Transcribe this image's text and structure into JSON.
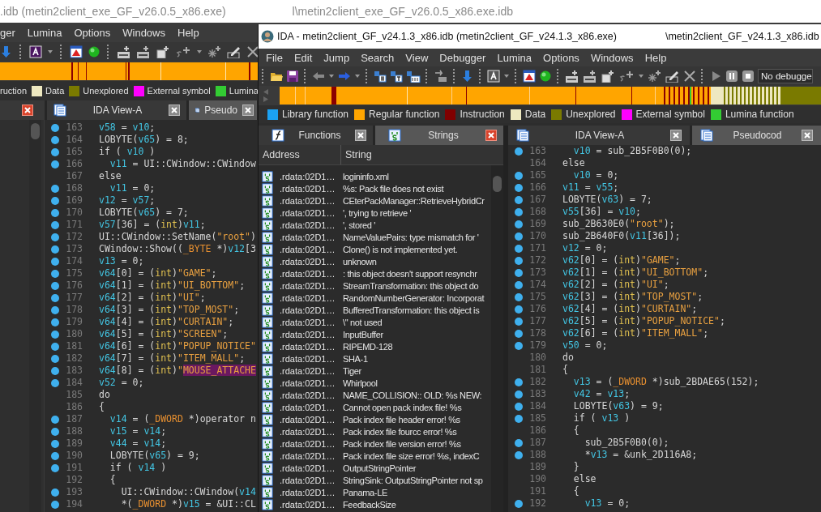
{
  "back_window": {
    "title": ".idb (metin2client_exe_GF_v26.0.5_x86.exe)",
    "title_path": "l\\metin2client_exe_GF_v26.0.5_x86.exe.idb",
    "menu": [
      "ger",
      "Lumina",
      "Options",
      "Windows",
      "Help"
    ],
    "legend": [
      {
        "label": "ruction"
      },
      {
        "label": "Data",
        "color": "#eee8c0"
      },
      {
        "label": "Unexplored",
        "color": "#7a7a00"
      },
      {
        "label": "External symbol",
        "color": "#ff00ff"
      },
      {
        "label": "Lumina",
        "color": "#33cc33"
      }
    ],
    "tabs": [
      {
        "selected": false,
        "active": true
      },
      {
        "label": "IDA View-A",
        "selected": false,
        "active": false
      },
      {
        "label": "Pseudo",
        "selected": true,
        "active": false
      }
    ],
    "code_lines": [
      {
        "no": "163",
        "dot": true,
        "kind": "top",
        "tokens": [
          {
            "kind": "var",
            "text": "v58"
          },
          {
            "kind": "plain",
            "text": " = "
          },
          {
            "kind": "var",
            "text": "v10"
          },
          {
            "kind": "plain",
            "text": ";"
          }
        ]
      },
      {
        "no": "164",
        "dot": true,
        "kind": "top",
        "tokens": [
          {
            "kind": "plain",
            "text": "LOBYTE("
          },
          {
            "kind": "var",
            "text": "v65"
          },
          {
            "kind": "plain",
            "text": ") = 8;"
          }
        ]
      },
      {
        "no": "165",
        "dot": true,
        "kind": "top",
        "tokens": [
          {
            "kind": "plain",
            "text": "if ( "
          },
          {
            "kind": "var",
            "text": "v10"
          },
          {
            "kind": "plain",
            "text": " )"
          }
        ]
      },
      {
        "no": "166",
        "dot": true,
        "kind": "inner",
        "tokens": [
          {
            "kind": "var",
            "text": "v11"
          },
          {
            "kind": "plain",
            "text": " = UI::CWindow::CWindow"
          }
        ]
      },
      {
        "no": "167",
        "dot": false,
        "kind": "top",
        "tokens": [
          {
            "kind": "plain",
            "text": "else"
          }
        ]
      },
      {
        "no": "168",
        "dot": true,
        "kind": "inner",
        "tokens": [
          {
            "kind": "var",
            "text": "v11"
          },
          {
            "kind": "plain",
            "text": " = 0;"
          }
        ]
      },
      {
        "no": "169",
        "dot": true,
        "kind": "top",
        "tokens": [
          {
            "kind": "var",
            "text": "v12"
          },
          {
            "kind": "plain",
            "text": " = "
          },
          {
            "kind": "var",
            "text": "v57"
          },
          {
            "kind": "plain",
            "text": ";"
          }
        ]
      },
      {
        "no": "170",
        "dot": true,
        "kind": "top",
        "tokens": [
          {
            "kind": "plain",
            "text": "LOBYTE("
          },
          {
            "kind": "var",
            "text": "v65"
          },
          {
            "kind": "plain",
            "text": ") = 7;"
          }
        ]
      },
      {
        "no": "171",
        "dot": true,
        "kind": "top",
        "tokens": [
          {
            "kind": "var",
            "text": "v57"
          },
          {
            "kind": "plain",
            "text": "[36] = ("
          },
          {
            "kind": "type",
            "text": "int"
          },
          {
            "kind": "plain",
            "text": ")"
          },
          {
            "kind": "var",
            "text": "v11"
          },
          {
            "kind": "plain",
            "text": ";"
          }
        ]
      },
      {
        "no": "172",
        "dot": true,
        "kind": "top",
        "tokens": [
          {
            "kind": "plain",
            "text": "UI::CWindow::SetName("
          },
          {
            "kind": "str",
            "text": "\"root\""
          },
          {
            "kind": "plain",
            "text": ")"
          }
        ]
      },
      {
        "no": "173",
        "dot": true,
        "kind": "top",
        "tokens": [
          {
            "kind": "plain",
            "text": "CWindow::Show(("
          },
          {
            "kind": "ptr",
            "text": "_BYTE"
          },
          {
            "kind": "plain",
            "text": " *)"
          },
          {
            "kind": "var",
            "text": "v12"
          },
          {
            "kind": "plain",
            "text": "[3"
          }
        ]
      },
      {
        "no": "174",
        "dot": true,
        "kind": "top",
        "tokens": [
          {
            "kind": "var",
            "text": "v13"
          },
          {
            "kind": "plain",
            "text": " = 0;"
          }
        ]
      },
      {
        "no": "175",
        "dot": true,
        "kind": "top",
        "tokens": [
          {
            "kind": "var",
            "text": "v64"
          },
          {
            "kind": "plain",
            "text": "[0] = ("
          },
          {
            "kind": "type",
            "text": "int"
          },
          {
            "kind": "plain",
            "text": ")"
          },
          {
            "kind": "str",
            "text": "\"GAME\""
          },
          {
            "kind": "plain",
            "text": ";"
          }
        ]
      },
      {
        "no": "176",
        "dot": true,
        "kind": "top",
        "tokens": [
          {
            "kind": "var",
            "text": "v64"
          },
          {
            "kind": "plain",
            "text": "[1] = ("
          },
          {
            "kind": "type",
            "text": "int"
          },
          {
            "kind": "plain",
            "text": ")"
          },
          {
            "kind": "str",
            "text": "\"UI_BOTTOM\""
          },
          {
            "kind": "plain",
            "text": ";"
          }
        ]
      },
      {
        "no": "177",
        "dot": true,
        "kind": "top",
        "tokens": [
          {
            "kind": "var",
            "text": "v64"
          },
          {
            "kind": "plain",
            "text": "[2] = ("
          },
          {
            "kind": "type",
            "text": "int"
          },
          {
            "kind": "plain",
            "text": ")"
          },
          {
            "kind": "str",
            "text": "\"UI\""
          },
          {
            "kind": "plain",
            "text": ";"
          }
        ]
      },
      {
        "no": "178",
        "dot": true,
        "kind": "top",
        "tokens": [
          {
            "kind": "var",
            "text": "v64"
          },
          {
            "kind": "plain",
            "text": "[3] = ("
          },
          {
            "kind": "type",
            "text": "int"
          },
          {
            "kind": "plain",
            "text": ")"
          },
          {
            "kind": "str",
            "text": "\"TOP_MOST\""
          },
          {
            "kind": "plain",
            "text": ";"
          }
        ]
      },
      {
        "no": "179",
        "dot": true,
        "kind": "top",
        "tokens": [
          {
            "kind": "var",
            "text": "v64"
          },
          {
            "kind": "plain",
            "text": "[4] = ("
          },
          {
            "kind": "type",
            "text": "int"
          },
          {
            "kind": "plain",
            "text": ")"
          },
          {
            "kind": "str",
            "text": "\"CURTAIN\""
          },
          {
            "kind": "plain",
            "text": ";"
          }
        ]
      },
      {
        "no": "180",
        "dot": true,
        "kind": "top",
        "tokens": [
          {
            "kind": "var",
            "text": "v64"
          },
          {
            "kind": "plain",
            "text": "[5] = ("
          },
          {
            "kind": "type",
            "text": "int"
          },
          {
            "kind": "plain",
            "text": ")"
          },
          {
            "kind": "str",
            "text": "\"SCREEN\""
          },
          {
            "kind": "plain",
            "text": ";"
          }
        ]
      },
      {
        "no": "181",
        "dot": true,
        "kind": "top",
        "tokens": [
          {
            "kind": "var",
            "text": "v64"
          },
          {
            "kind": "plain",
            "text": "[6] = ("
          },
          {
            "kind": "type",
            "text": "int"
          },
          {
            "kind": "plain",
            "text": ")"
          },
          {
            "kind": "str",
            "text": "\"POPUP_NOTICE\""
          }
        ]
      },
      {
        "no": "182",
        "dot": true,
        "kind": "top",
        "tokens": [
          {
            "kind": "var",
            "text": "v64"
          },
          {
            "kind": "plain",
            "text": "[7] = ("
          },
          {
            "kind": "type",
            "text": "int"
          },
          {
            "kind": "plain",
            "text": ")"
          },
          {
            "kind": "str",
            "text": "\"ITEM_MALL\""
          },
          {
            "kind": "plain",
            "text": ";"
          }
        ]
      },
      {
        "no": "183",
        "dot": true,
        "kind": "top",
        "tokens": [
          {
            "kind": "var",
            "text": "v64"
          },
          {
            "kind": "plain",
            "text": "[8] = ("
          },
          {
            "kind": "type",
            "text": "int"
          },
          {
            "kind": "plain",
            "text": ")"
          },
          {
            "kind": "str",
            "text": "\""
          },
          {
            "kind": "match",
            "text": "MOUSE_ATTACHE"
          }
        ]
      },
      {
        "no": "184",
        "dot": true,
        "kind": "top",
        "tokens": [
          {
            "kind": "var",
            "text": "v52"
          },
          {
            "kind": "plain",
            "text": " = 0;"
          }
        ]
      },
      {
        "no": "185",
        "dot": false,
        "kind": "top",
        "tokens": [
          {
            "kind": "plain",
            "text": "do"
          }
        ]
      },
      {
        "no": "186",
        "dot": false,
        "kind": "top",
        "tokens": [
          {
            "kind": "plain",
            "text": "{"
          }
        ]
      },
      {
        "no": "187",
        "dot": true,
        "kind": "inner",
        "tokens": [
          {
            "kind": "var",
            "text": "v14"
          },
          {
            "kind": "plain",
            "text": " = ("
          },
          {
            "kind": "ptr",
            "text": "_DWORD"
          },
          {
            "kind": "plain",
            "text": " *)operator n"
          }
        ]
      },
      {
        "no": "188",
        "dot": true,
        "kind": "inner",
        "tokens": [
          {
            "kind": "var",
            "text": "v15"
          },
          {
            "kind": "plain",
            "text": " = "
          },
          {
            "kind": "var",
            "text": "v14"
          },
          {
            "kind": "plain",
            "text": ";"
          }
        ]
      },
      {
        "no": "189",
        "dot": true,
        "kind": "inner",
        "tokens": [
          {
            "kind": "var",
            "text": "v44"
          },
          {
            "kind": "plain",
            "text": " = "
          },
          {
            "kind": "var",
            "text": "v14"
          },
          {
            "kind": "plain",
            "text": ";"
          }
        ]
      },
      {
        "no": "190",
        "dot": true,
        "kind": "inner",
        "tokens": [
          {
            "kind": "plain",
            "text": "LOBYTE("
          },
          {
            "kind": "var",
            "text": "v65"
          },
          {
            "kind": "plain",
            "text": ") = 9;"
          }
        ]
      },
      {
        "no": "191",
        "dot": true,
        "kind": "inner",
        "tokens": [
          {
            "kind": "plain",
            "text": "if ( "
          },
          {
            "kind": "var",
            "text": "v14"
          },
          {
            "kind": "plain",
            "text": " )"
          }
        ]
      },
      {
        "no": "192",
        "dot": false,
        "kind": "inner",
        "tokens": [
          {
            "kind": "plain",
            "text": "{"
          }
        ]
      },
      {
        "no": "193",
        "dot": true,
        "kind": "deep",
        "tokens": [
          {
            "kind": "plain",
            "text": "UI::CWindow::CWindow("
          },
          {
            "kind": "var",
            "text": "v14"
          }
        ]
      },
      {
        "no": "194",
        "dot": true,
        "kind": "deep",
        "tokens": [
          {
            "kind": "plain",
            "text": "*("
          },
          {
            "kind": "ptr",
            "text": "_DWORD"
          },
          {
            "kind": "plain",
            "text": " *)"
          },
          {
            "kind": "var",
            "text": "v15"
          },
          {
            "kind": "plain",
            "text": " = &UI::CL"
          }
        ]
      }
    ]
  },
  "front_window": {
    "title": "IDA - metin2client_GF_v24.1.3_x86.idb (metin2client_GF_v24.1.3_x86.exe)",
    "title_path": "\\metin2client_GF_v24.1.3_x86.idb",
    "menu": [
      "File",
      "Edit",
      "Jump",
      "Search",
      "View",
      "Debugger",
      "Lumina",
      "Options",
      "Windows",
      "Help"
    ],
    "debugger_select": {
      "value": "No debugge"
    },
    "legend": [
      {
        "label": "Library function",
        "color": "#1ba1f2"
      },
      {
        "label": "Regular function",
        "color": "#ffa500"
      },
      {
        "label": "Instruction",
        "color": "#800000"
      },
      {
        "label": "Data",
        "color": "#eee8c0"
      },
      {
        "label": "Unexplored",
        "color": "#7a7a00"
      },
      {
        "label": "External symbol",
        "color": "#ff00ff"
      },
      {
        "label": "Lumina function",
        "color": "#33cc33"
      }
    ],
    "left_tabs": [
      {
        "kind": "functions",
        "label": "Functions",
        "selected": false,
        "active": false
      },
      {
        "kind": "strings",
        "label": "Strings",
        "selected": true,
        "active": true
      }
    ],
    "strings_table": {
      "columns": [
        "Address",
        "String"
      ],
      "rows": [
        {
          "address": ".rdata:02D1…",
          "string": "logininfo.xml"
        },
        {
          "address": ".rdata:02D1…",
          "string": "%s: Pack file does not exist"
        },
        {
          "address": ".rdata:02D1…",
          "string": "CEterPackManager::RetrieveHybridCr"
        },
        {
          "address": ".rdata:02D1…",
          "string": "', trying to retrieve '"
        },
        {
          "address": ".rdata:02D1…",
          "string": "', stored '"
        },
        {
          "address": ".rdata:02D1…",
          "string": "NameValuePairs: type mismatch for '"
        },
        {
          "address": ".rdata:02D1…",
          "string": "Clone() is not implemented yet."
        },
        {
          "address": ".rdata:02D1…",
          "string": "unknown"
        },
        {
          "address": ".rdata:02D1…",
          "string": ": this object doesn't support resynchr"
        },
        {
          "address": ".rdata:02D1…",
          "string": "StreamTransformation: this object do"
        },
        {
          "address": ".rdata:02D1…",
          "string": "RandomNumberGenerator: Incorporat"
        },
        {
          "address": ".rdata:02D1…",
          "string": "BufferedTransformation: this object is"
        },
        {
          "address": ".rdata:02D1…",
          "string": "\\\" not used"
        },
        {
          "address": ".rdata:02D1…",
          "string": "InputBuffer"
        },
        {
          "address": ".rdata:02D1…",
          "string": "RIPEMD-128"
        },
        {
          "address": ".rdata:02D1…",
          "string": "SHA-1"
        },
        {
          "address": ".rdata:02D1…",
          "string": "Tiger"
        },
        {
          "address": ".rdata:02D1…",
          "string": "Whirlpool"
        },
        {
          "address": ".rdata:02D1…",
          "string": "NAME_COLLISION:: OLD: %s NEW:"
        },
        {
          "address": ".rdata:02D1…",
          "string": "Cannot open pack index file! %s"
        },
        {
          "address": ".rdata:02D1…",
          "string": "Pack index file header error! %s"
        },
        {
          "address": ".rdata:02D1…",
          "string": "Pack index file fourcc error! %s"
        },
        {
          "address": ".rdata:02D1…",
          "string": "Pack index file version error! %s"
        },
        {
          "address": ".rdata:02D1…",
          "string": "Pack index file size error! %s, indexC"
        },
        {
          "address": ".rdata:02D1…",
          "string": "OutputStringPointer"
        },
        {
          "address": ".rdata:02D1…",
          "string": "StringSink: OutputStringPointer not sp"
        },
        {
          "address": ".rdata:02D1…",
          "string": "Panama-LE"
        },
        {
          "address": ".rdata:02D1…",
          "string": "FeedbackSize"
        }
      ]
    },
    "right_tabs": [
      {
        "label": "IDA View-A",
        "selected": false,
        "active": false
      },
      {
        "label": "Pseudocod",
        "selected": true,
        "active": false
      }
    ],
    "code_lines": [
      {
        "no": "163",
        "dot": true,
        "kind": "inner",
        "tokens": [
          {
            "kind": "var",
            "text": "v10"
          },
          {
            "kind": "plain",
            "text": " = sub_2B5F0B0(0);"
          }
        ]
      },
      {
        "no": "164",
        "dot": false,
        "kind": "top",
        "tokens": [
          {
            "kind": "plain",
            "text": "else"
          }
        ]
      },
      {
        "no": "165",
        "dot": true,
        "kind": "inner",
        "tokens": [
          {
            "kind": "var",
            "text": "v10"
          },
          {
            "kind": "plain",
            "text": " = 0;"
          }
        ]
      },
      {
        "no": "166",
        "dot": true,
        "kind": "top",
        "tokens": [
          {
            "kind": "var",
            "text": "v11"
          },
          {
            "kind": "plain",
            "text": " = "
          },
          {
            "kind": "var",
            "text": "v55"
          },
          {
            "kind": "plain",
            "text": ";"
          }
        ]
      },
      {
        "no": "167",
        "dot": true,
        "kind": "top",
        "tokens": [
          {
            "kind": "plain",
            "text": "LOBYTE("
          },
          {
            "kind": "var",
            "text": "v63"
          },
          {
            "kind": "plain",
            "text": ") = 7;"
          }
        ]
      },
      {
        "no": "168",
        "dot": true,
        "kind": "top",
        "tokens": [
          {
            "kind": "var",
            "text": "v55"
          },
          {
            "kind": "plain",
            "text": "[36] = "
          },
          {
            "kind": "var",
            "text": "v10"
          },
          {
            "kind": "plain",
            "text": ";"
          }
        ]
      },
      {
        "no": "169",
        "dot": true,
        "kind": "top",
        "tokens": [
          {
            "kind": "plain",
            "text": "sub_2B630E0("
          },
          {
            "kind": "str",
            "text": "\"root\""
          },
          {
            "kind": "plain",
            "text": ");"
          }
        ]
      },
      {
        "no": "170",
        "dot": true,
        "kind": "top",
        "tokens": [
          {
            "kind": "plain",
            "text": "sub_2B640F0("
          },
          {
            "kind": "var",
            "text": "v11"
          },
          {
            "kind": "plain",
            "text": "[36]);"
          }
        ]
      },
      {
        "no": "171",
        "dot": true,
        "kind": "top",
        "tokens": [
          {
            "kind": "var",
            "text": "v12"
          },
          {
            "kind": "plain",
            "text": " = 0;"
          }
        ]
      },
      {
        "no": "172",
        "dot": true,
        "kind": "top",
        "tokens": [
          {
            "kind": "var",
            "text": "v62"
          },
          {
            "kind": "plain",
            "text": "[0] = ("
          },
          {
            "kind": "type",
            "text": "int"
          },
          {
            "kind": "plain",
            "text": ")"
          },
          {
            "kind": "str",
            "text": "\"GAME\""
          },
          {
            "kind": "plain",
            "text": ";"
          }
        ]
      },
      {
        "no": "173",
        "dot": true,
        "kind": "top",
        "tokens": [
          {
            "kind": "var",
            "text": "v62"
          },
          {
            "kind": "plain",
            "text": "[1] = ("
          },
          {
            "kind": "type",
            "text": "int"
          },
          {
            "kind": "plain",
            "text": ")"
          },
          {
            "kind": "str",
            "text": "\"UI_BOTTOM\""
          },
          {
            "kind": "plain",
            "text": ";"
          }
        ]
      },
      {
        "no": "174",
        "dot": true,
        "kind": "top",
        "tokens": [
          {
            "kind": "var",
            "text": "v62"
          },
          {
            "kind": "plain",
            "text": "[2] = ("
          },
          {
            "kind": "type",
            "text": "int"
          },
          {
            "kind": "plain",
            "text": ")"
          },
          {
            "kind": "str",
            "text": "\"UI\""
          },
          {
            "kind": "plain",
            "text": ";"
          }
        ]
      },
      {
        "no": "175",
        "dot": true,
        "kind": "top",
        "tokens": [
          {
            "kind": "var",
            "text": "v62"
          },
          {
            "kind": "plain",
            "text": "[3] = ("
          },
          {
            "kind": "type",
            "text": "int"
          },
          {
            "kind": "plain",
            "text": ")"
          },
          {
            "kind": "str",
            "text": "\"TOP_MOST\""
          },
          {
            "kind": "plain",
            "text": ";"
          }
        ]
      },
      {
        "no": "176",
        "dot": true,
        "kind": "top",
        "tokens": [
          {
            "kind": "var",
            "text": "v62"
          },
          {
            "kind": "plain",
            "text": "[4] = ("
          },
          {
            "kind": "type",
            "text": "int"
          },
          {
            "kind": "plain",
            "text": ")"
          },
          {
            "kind": "str",
            "text": "\"CURTAIN\""
          },
          {
            "kind": "plain",
            "text": ";"
          }
        ]
      },
      {
        "no": "177",
        "dot": true,
        "kind": "top",
        "tokens": [
          {
            "kind": "var",
            "text": "v62"
          },
          {
            "kind": "plain",
            "text": "[5] = ("
          },
          {
            "kind": "type",
            "text": "int"
          },
          {
            "kind": "plain",
            "text": ")"
          },
          {
            "kind": "str",
            "text": "\"POPUP_NOTICE\""
          },
          {
            "kind": "plain",
            "text": ";"
          }
        ]
      },
      {
        "no": "178",
        "dot": true,
        "kind": "top",
        "tokens": [
          {
            "kind": "var",
            "text": "v62"
          },
          {
            "kind": "plain",
            "text": "[6] = ("
          },
          {
            "kind": "type",
            "text": "int"
          },
          {
            "kind": "plain",
            "text": ")"
          },
          {
            "kind": "str",
            "text": "\"ITEM_MALL\""
          },
          {
            "kind": "plain",
            "text": ";"
          }
        ]
      },
      {
        "no": "179",
        "dot": true,
        "kind": "top",
        "tokens": [
          {
            "kind": "var",
            "text": "v50"
          },
          {
            "kind": "plain",
            "text": " = 0;"
          }
        ]
      },
      {
        "no": "180",
        "dot": false,
        "kind": "top",
        "tokens": [
          {
            "kind": "plain",
            "text": "do"
          }
        ]
      },
      {
        "no": "181",
        "dot": false,
        "kind": "top",
        "tokens": [
          {
            "kind": "plain",
            "text": "{"
          }
        ]
      },
      {
        "no": "182",
        "dot": true,
        "kind": "inner",
        "tokens": [
          {
            "kind": "var",
            "text": "v13"
          },
          {
            "kind": "plain",
            "text": " = ("
          },
          {
            "kind": "ptr",
            "text": "_DWORD"
          },
          {
            "kind": "plain",
            "text": " *)sub_2BDAE65(152);"
          }
        ]
      },
      {
        "no": "183",
        "dot": true,
        "kind": "inner",
        "tokens": [
          {
            "kind": "var",
            "text": "v42"
          },
          {
            "kind": "plain",
            "text": " = "
          },
          {
            "kind": "var",
            "text": "v13"
          },
          {
            "kind": "plain",
            "text": ";"
          }
        ]
      },
      {
        "no": "184",
        "dot": true,
        "kind": "inner",
        "tokens": [
          {
            "kind": "plain",
            "text": "LOBYTE("
          },
          {
            "kind": "var",
            "text": "v63"
          },
          {
            "kind": "plain",
            "text": ") = 9;"
          }
        ]
      },
      {
        "no": "185",
        "dot": true,
        "kind": "inner",
        "tokens": [
          {
            "kind": "plain",
            "text": "if ( "
          },
          {
            "kind": "var",
            "text": "v13"
          },
          {
            "kind": "plain",
            "text": " )"
          }
        ]
      },
      {
        "no": "186",
        "dot": false,
        "kind": "inner",
        "tokens": [
          {
            "kind": "plain",
            "text": "{"
          }
        ]
      },
      {
        "no": "187",
        "dot": true,
        "kind": "deep",
        "tokens": [
          {
            "kind": "plain",
            "text": "sub_2B5F0B0(0);"
          }
        ]
      },
      {
        "no": "188",
        "dot": true,
        "kind": "deep",
        "tokens": [
          {
            "kind": "plain",
            "text": "*"
          },
          {
            "kind": "var",
            "text": "v13"
          },
          {
            "kind": "plain",
            "text": " = &unk_2D116A8;"
          }
        ]
      },
      {
        "no": "189",
        "dot": false,
        "kind": "inner",
        "tokens": [
          {
            "kind": "plain",
            "text": "}"
          }
        ]
      },
      {
        "no": "190",
        "dot": false,
        "kind": "inner",
        "tokens": [
          {
            "kind": "plain",
            "text": "else"
          }
        ]
      },
      {
        "no": "191",
        "dot": false,
        "kind": "inner",
        "tokens": [
          {
            "kind": "plain",
            "text": "{"
          }
        ]
      },
      {
        "no": "192",
        "dot": true,
        "kind": "deep",
        "tokens": [
          {
            "kind": "var",
            "text": "v13"
          },
          {
            "kind": "plain",
            "text": " = 0;"
          }
        ]
      }
    ]
  }
}
